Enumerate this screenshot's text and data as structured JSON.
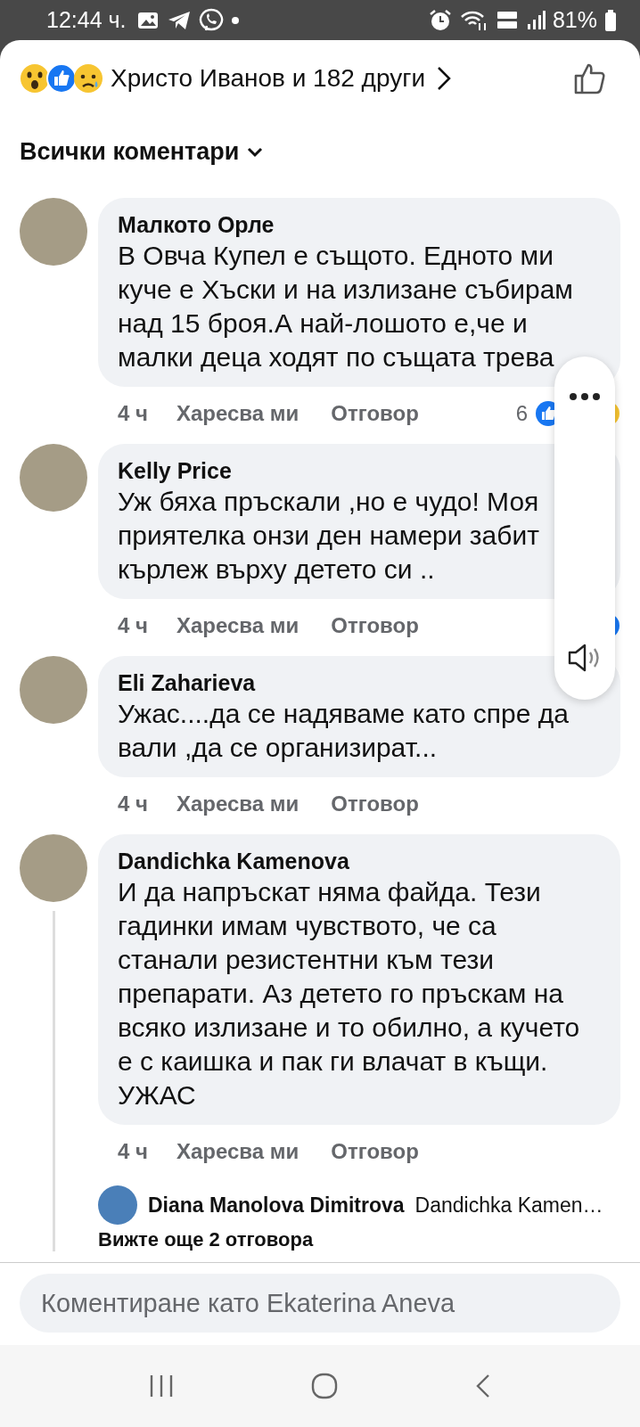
{
  "status_bar": {
    "time": "12:44 ч.",
    "battery": "81%"
  },
  "header": {
    "reactions_text": "Христо Иванов и 182 други"
  },
  "filter": {
    "label": "Всички коментари"
  },
  "comments": [
    {
      "author": "Малкото Орле",
      "text": "В Овча Купел е същото. Едното ми куче е Хъски и на излизане събирам над 15 броя.А най-лошото е,че и малки деца ходят по същата трева",
      "time": "4 ч",
      "like": "Харесва ми",
      "reply": "Отговор",
      "reactions": true,
      "reaction_count": "6"
    },
    {
      "author": "Kelly Price",
      "text": "Уж бяха пръскали ,но е чудо! Моя приятелка онзи ден намери забит кърлеж върху детето си ..",
      "time": "4 ч",
      "like": "Харесва ми",
      "reply": "Отговор",
      "reactions": true
    },
    {
      "author": "Eli Zaharieva",
      "text": "Ужас....да се надяваме като спре да вали ,да се организират...",
      "time": "4 ч",
      "like": "Харесва ми",
      "reply": "Отговор",
      "reactions": false
    },
    {
      "author": "Dandichka Kamenova",
      "text": "И да напръскат няма файда. Тези гадинки имам чувството, че са станали резистентни към тези препарати. Аз детето го пръскам на всяко излизане и то обилно, а кучето е с каишка и пак ги влачат в къщи. УЖАС",
      "time": "4 ч",
      "like": "Харесва ми",
      "reply": "Отговор",
      "reactions": false,
      "replies": [
        {
          "author": "Diana Manolova Dimitrova",
          "text": "Dandichka Kamen…"
        }
      ],
      "more_replies": "Вижте още 2 отговора"
    }
  ],
  "composer": {
    "placeholder": "Коментиране като Ekaterina Aneva"
  }
}
